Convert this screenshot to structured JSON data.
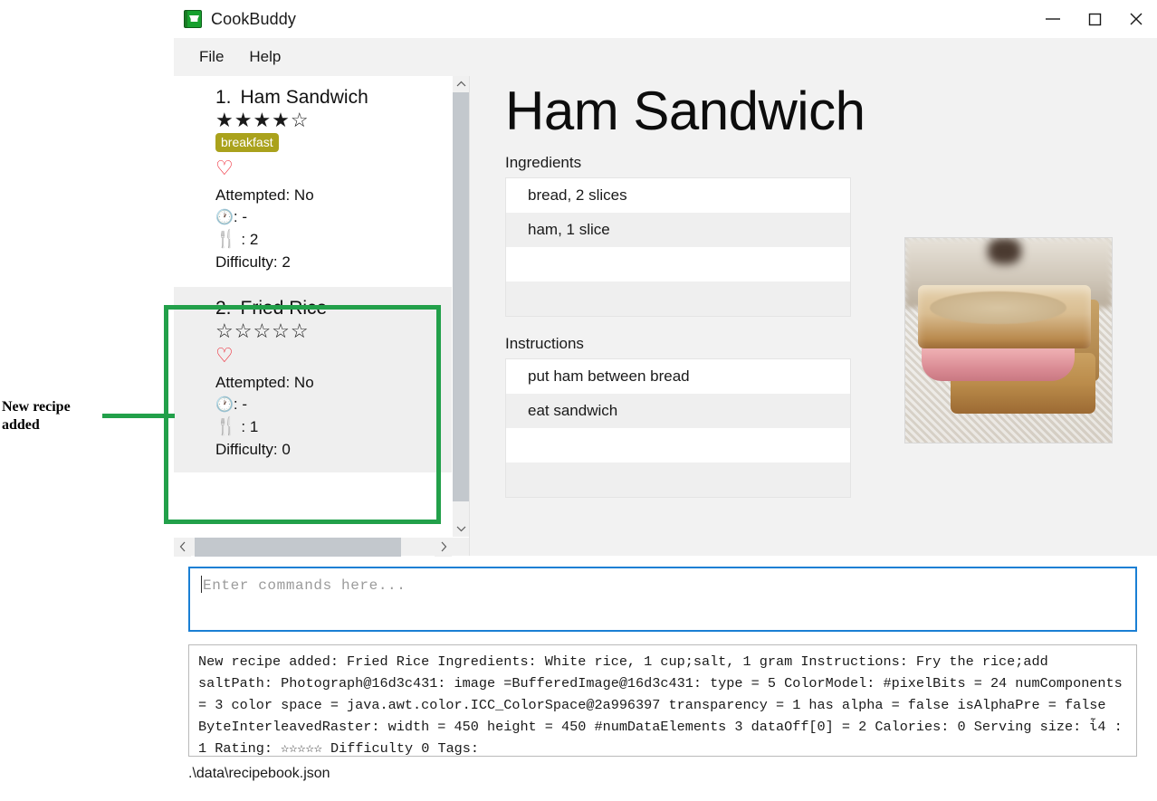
{
  "window": {
    "title": "CookBuddy",
    "icon": "cookbook-icon",
    "controls": {
      "minimize": "minimize-icon",
      "maximize": "maximize-icon",
      "close": "close-icon"
    }
  },
  "menu": {
    "items": [
      {
        "label": "File"
      },
      {
        "label": "Help"
      }
    ]
  },
  "recipe_list": {
    "items": [
      {
        "number": "1.",
        "name": "Ham Sandwich",
        "stars": "★★★★☆",
        "tags": [
          "breakfast"
        ],
        "favorite_icon": "♡",
        "attempted": "Attempted: No",
        "time_label": ": -",
        "serving_label": " : 2",
        "difficulty": "Difficulty: 2",
        "selected": false
      },
      {
        "number": "2.",
        "name": "Fried Rice",
        "stars": "☆☆☆☆☆",
        "tags": [],
        "favorite_icon": "♡",
        "attempted": "Attempted: No",
        "time_label": ": -",
        "serving_label": " : 1",
        "difficulty": "Difficulty: 0",
        "selected": true
      }
    ],
    "scrollbars": {
      "up_arrow": "⌃",
      "down_arrow": "⌄",
      "left_arrow": "‹",
      "right_arrow": "›"
    }
  },
  "detail": {
    "title": "Ham Sandwich",
    "ingredients_label": "Ingredients",
    "ingredients": [
      "bread, 2 slices",
      "ham, 1 slice",
      "",
      ""
    ],
    "instructions_label": "Instructions",
    "instructions": [
      "put ham between bread",
      "eat sandwich",
      "",
      ""
    ],
    "photo": "ham-sandwich-photo"
  },
  "command_bar": {
    "placeholder": "Enter commands here...",
    "value": ""
  },
  "console": {
    "text": "New recipe added: Fried Rice Ingredients: White rice, 1 cup;salt, 1 gram Instructions: Fry the rice;add saltPath: Photograph@16d3c431: image =BufferedImage@16d3c431: type = 5 ColorModel: #pixelBits = 24 numComponents = 3 color space = java.awt.color.ICC_ColorSpace@2a996397 transparency = 1 has alpha = false isAlphaPre = false ByteInterleavedRaster: width = 450 height = 450 #numDataElements 3 dataOff[0] = 2 Calories: 0 Serving size: ἷ4 : 1 Rating: ☆☆☆☆☆ Difficulty 0 Tags:"
  },
  "status_bar": {
    "path": ".\\data\\recipebook.json"
  },
  "annotation": {
    "label": "New recipe\nadded",
    "color": "#22a04a"
  },
  "colors": {
    "accent_green": "#22a04a",
    "tag_olive": "#aaa21c",
    "heart_red": "#ee1d2b",
    "focus_blue": "#1a7fd4",
    "panel_gray": "#f2f2f2",
    "row_alt_gray": "#efefef"
  }
}
